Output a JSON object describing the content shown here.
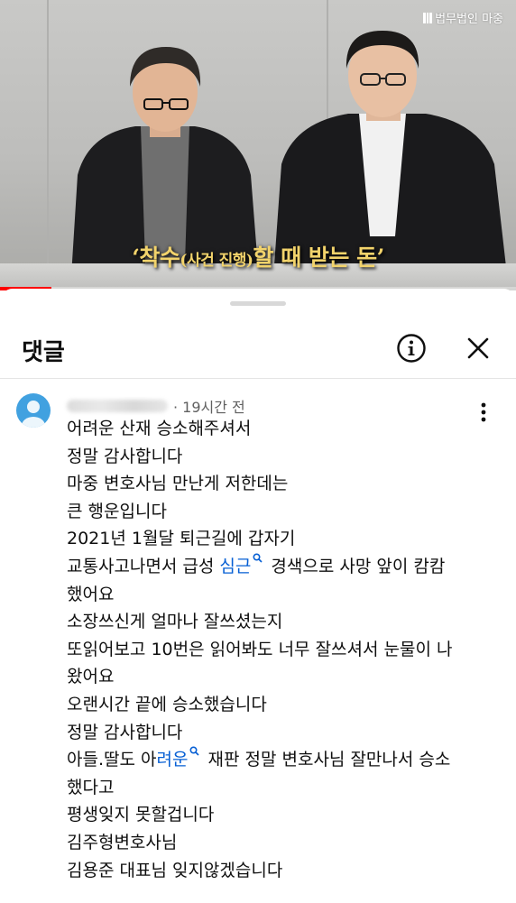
{
  "video": {
    "watermark": "법무법인 마중",
    "caption": {
      "prefix": "‘착수",
      "paren": "(사건 진행)",
      "suffix": "할 때 받는 돈’"
    },
    "progress_fraction": 0.1
  },
  "comments_sheet": {
    "title": "댓글",
    "header_icons": [
      "info-icon",
      "close-icon"
    ]
  },
  "comment": {
    "time_ago": "· 19시간 전",
    "lines": {
      "l1": "어려운 산재 승소해주셔서",
      "l2": "정말 감사합니다",
      "l3": "마중 변호사님 만난게 저한데는",
      "l4": "큰 행운입니다",
      "l5": "2021년 1월달 퇴근길에 갑자기",
      "l6_a": "교통사고나면서 급성 ",
      "l6_kw": "심근",
      "l6_b": " 경색으로 사망 앞이 캄캄",
      "l7": "했어요",
      "l8": "소장쓰신게 얼마나 잘쓰셨는지",
      "l9": "또읽어보고 10번은 읽어봐도 너무 잘쓰셔서 눈물이 나",
      "l10": "왔어요",
      "l11": "오랜시간 끝에 승소했습니다",
      "l12": "정말 감사합니다",
      "l13_a": "아들.딸도 아",
      "l13_kw": "려운",
      "l13_b": " 재판 정말 변호사님 잘만나서 승소",
      "l14": "했다고",
      "l15": "평생잊지 못할겁니다",
      "l16": "김주형변호사님",
      "l17": "김용준 대표님 잊지않겠습니다"
    }
  },
  "colors": {
    "link": "#065fd4",
    "caption": "#f2d36b",
    "avatar": "#41a1e0",
    "progress": "#ff0000"
  }
}
